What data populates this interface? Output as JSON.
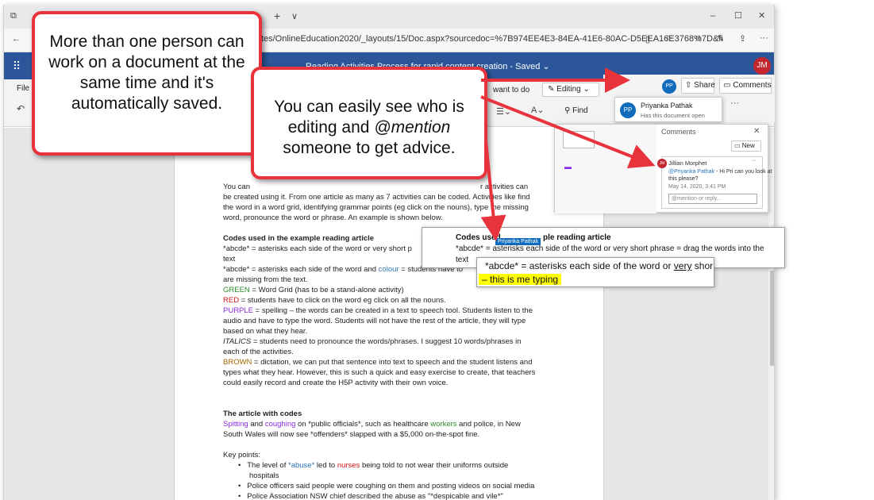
{
  "browser": {
    "url": "sites/OnlineEducation2020/_layouts/15/Doc.aspx?sourcedoc=%7B974EE4E3-84EA-41E6-80AC-D5EEA16E3768%7D&fi",
    "new_tab": "+",
    "tab_menu": "∨"
  },
  "word": {
    "title": "Reading Activities Process for rapid content creation  -  Saved ⌄",
    "avatar_initials": "JM",
    "file_tab": "File",
    "tell_me": "want to do",
    "editing": "Editing",
    "find": "Find",
    "share": "Share",
    "comments": "Comments",
    "more": "···"
  },
  "presence": {
    "initials": "PP",
    "name": "Priyanka Pathak",
    "status": "Has this document open"
  },
  "comments_panel": {
    "title": "Comments",
    "new": "New",
    "author": "Jillian Morphet",
    "author_initials": "JM",
    "mention": "@Priyanka Pathak",
    "body1": " - Hi Pri can you look at",
    "body2": "this please?",
    "date": "May 14, 2020, 3:41 PM",
    "reply_placeholder": "@mention or reply..."
  },
  "callouts": {
    "left": "More than one person can work on a document at the same time and it's automatically saved.",
    "middle_1": "You can easily see who is editing and ",
    "middle_mention": "@mention",
    "middle_2": " someone to get advice."
  },
  "doc": {
    "p1_l1a": "You can",
    "p1_l1b": "r activities can",
    "p1_l2": "be created using it. From one article as many as 7 activities can be coded. Activities like find",
    "p1_l3": "the word in a word grid, identifying grammar points (eg click on the nouns), type the missing",
    "p1_l4": "word, pronounce the word or phrase. An example is shown below.",
    "h_codes": "Codes used in the example reading article",
    "c1": "*abcde* = asterisks each side of the word or very short p",
    "c1b": "text",
    "c2a": "*abcde* = asterisks each side of the word and ",
    "c2_colour": "colour",
    "c2b": " = students have to",
    "c2c": "are missing from the text.",
    "green_word": "GREEN",
    "green_rest": " = Word Grid (has to be a stand-alone activity)",
    "red_word": "RED",
    "red_rest": " = students have to click on the word eg click on all the nouns.",
    "purple_word": "PURPLE",
    "purple_rest": " = spelling – the words can be created in a text to speech tool. Students listen to the",
    "purple_l2": "audio and have to type the word. Students will not have the rest of the article, they will type",
    "purple_l3": "based on what they hear.",
    "italics_word": "ITALICS",
    "italics_rest": " = students need to pronounce the words/phrases. I suggest 10 words/phrases in",
    "italics_l2": "each of the activities.",
    "brown_word": "BROWN",
    "brown_rest": " = dictation, we can put that sentence into text to speech and the student listens and",
    "brown_l2": "types what they hear. However, this is such a quick and easy exercise to create, that teachers",
    "brown_l3": "could easily record and create the H5P activity with their own voice.",
    "h_article": "The article with codes",
    "a1_spitting": "Spitting",
    "a1_and": " and ",
    "a1_coughing": "coughing",
    "a1_rest": " on *public officials*, such as healthcare ",
    "a1_workers": "workers",
    "a1_rest2": " and police, in New",
    "a2": "South Wales will now see *offenders* slapped with a $5,000 on-the-spot fine.",
    "keypoints": "Key points:",
    "kp1a": "The level of ",
    "kp1_abuse": "*abuse*",
    "kp1b": " led to ",
    "kp1_nurses": "nurses",
    "kp1c": " being told to not wear their uniforms outside",
    "kp1d": "hospitals",
    "kp2": "Police officers said people were coughing on them and posting videos on social media",
    "kp3": "Police Association NSW chief described the abuse as \"*despicable and vile*\""
  },
  "zoom_panel": {
    "heading_a": "Codes used",
    "heading_b": "ple reading article",
    "tag": "Priyanka Pathak",
    "line1a": "*abcde* = ",
    "line1b": "asterisks each side of the word or very short phrase = drag the words into the",
    "line2": "text"
  },
  "typing_panel": {
    "line1a": "*abcde* = asterisks each side of the word or ",
    "line1_very": "very",
    "line1b": " shor",
    "line2": "– this is me typing"
  },
  "colors": {
    "accent_red": "#e8323c",
    "ribbon_blue": "#2b579a",
    "highlight": "#ffff00"
  }
}
